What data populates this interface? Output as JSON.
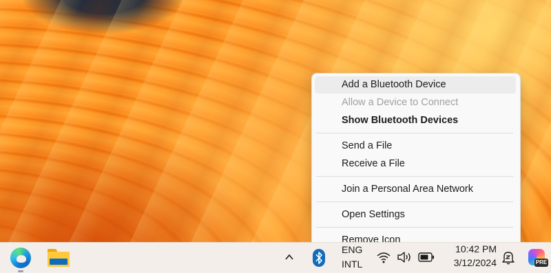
{
  "context_menu": {
    "items": [
      {
        "label": "Add a Bluetooth Device",
        "state": "hover"
      },
      {
        "label": "Allow a Device to Connect",
        "state": "disabled"
      },
      {
        "label": "Show Bluetooth Devices",
        "state": "default-bold"
      },
      {
        "label": "Send a File",
        "state": "normal"
      },
      {
        "label": "Receive a File",
        "state": "normal"
      },
      {
        "label": "Join a Personal Area Network",
        "state": "normal"
      },
      {
        "label": "Open Settings",
        "state": "normal"
      },
      {
        "label": "Remove Icon",
        "state": "normal"
      }
    ]
  },
  "taskbar": {
    "apps": [
      {
        "icon": "edge-icon"
      },
      {
        "icon": "file-explorer-icon"
      }
    ],
    "tray": {
      "chevron_icon": "chevron-up-icon",
      "bluetooth_icon": "bluetooth-icon",
      "language_line1": "ENG",
      "language_line2": "INTL",
      "wifi_icon": "wifi-icon",
      "volume_icon": "volume-icon",
      "battery_icon": "battery-icon",
      "time": "10:42 PM",
      "date": "3/12/2024",
      "notification_icon": "notification-bell-icon",
      "copilot_badge": "PRE"
    }
  },
  "colors": {
    "menu_bg": "#f9f9f9",
    "menu_hover": "#ececec",
    "disabled_text": "#a0a0a0",
    "taskbar_bg": "#f3eee9",
    "accent": "#0f6cbd"
  }
}
